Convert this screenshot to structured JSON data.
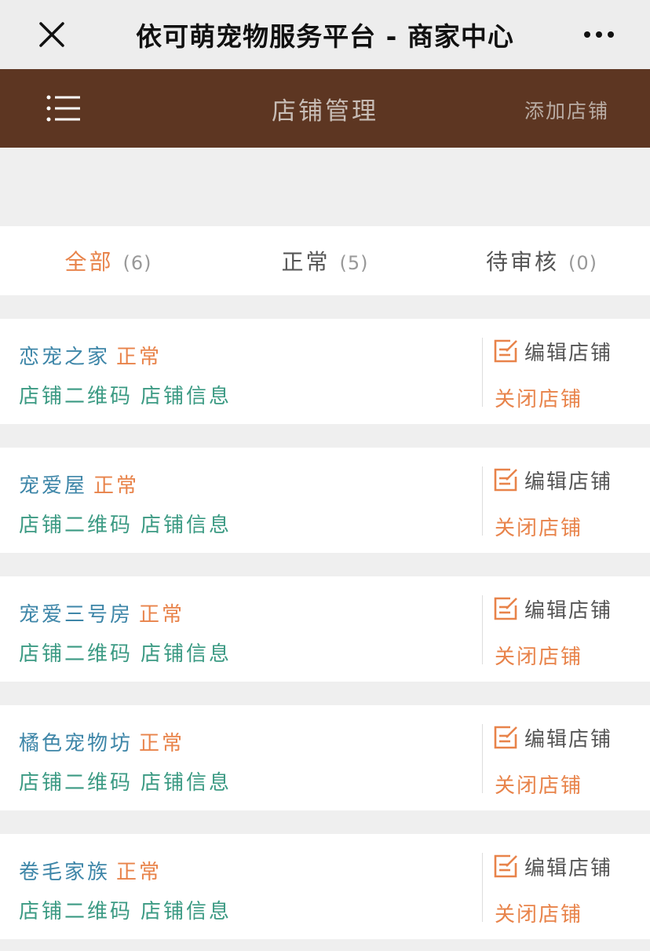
{
  "wechat_bar": {
    "title": "依可萌宠物服务平台 - 商家中心"
  },
  "header": {
    "title": "店铺管理",
    "add_label": "添加店铺"
  },
  "tabs": [
    {
      "label": "全部",
      "count": "(6)"
    },
    {
      "label": "正常",
      "count": "(5)"
    },
    {
      "label": "待审核",
      "count": "(0)"
    }
  ],
  "shops": [
    {
      "name": "恋宠之家",
      "status": "正常",
      "qr_label": "店铺二维码",
      "info_label": "店铺信息",
      "edit_label": "编辑店铺",
      "close_label": "关闭店铺"
    },
    {
      "name": "宠爱屋",
      "status": "正常",
      "qr_label": "店铺二维码",
      "info_label": "店铺信息",
      "edit_label": "编辑店铺",
      "close_label": "关闭店铺"
    },
    {
      "name": "宠爱三号房",
      "status": "正常",
      "qr_label": "店铺二维码",
      "info_label": "店铺信息",
      "edit_label": "编辑店铺",
      "close_label": "关闭店铺"
    },
    {
      "name": "橘色宠物坊",
      "status": "正常",
      "qr_label": "店铺二维码",
      "info_label": "店铺信息",
      "edit_label": "编辑店铺",
      "close_label": "关闭店铺"
    },
    {
      "name": "卷毛家族",
      "status": "正常",
      "qr_label": "店铺二维码",
      "info_label": "店铺信息",
      "edit_label": "编辑店铺",
      "close_label": "关闭店铺"
    }
  ],
  "icons": {
    "close": "close-icon",
    "more": "more-dots-icon",
    "menu": "menu-icon",
    "edit": "edit-icon"
  },
  "colors": {
    "header_bg": "#5d3622",
    "accent_orange": "#e8834a",
    "shop_name_blue": "#3e86a8",
    "link_green": "#3b9a83"
  }
}
